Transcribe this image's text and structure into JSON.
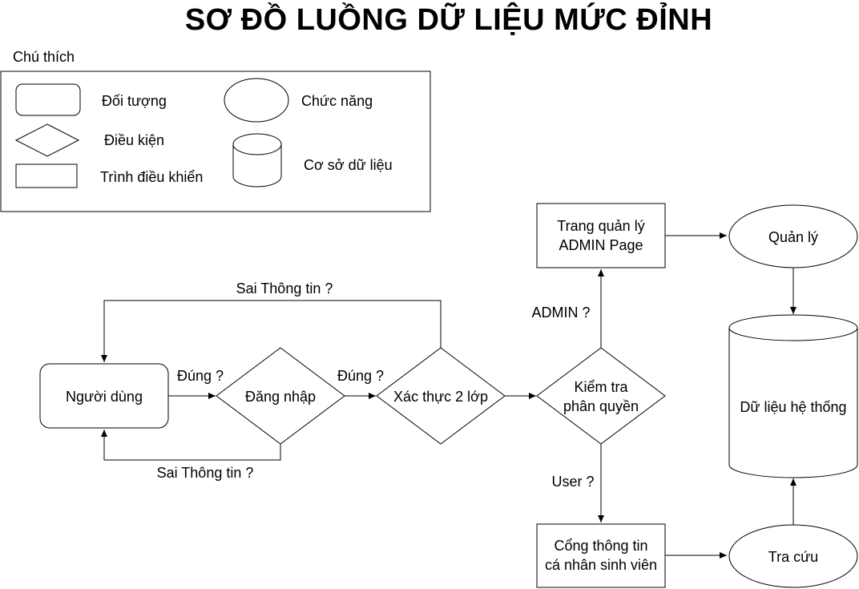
{
  "title": "SƠ ĐỒ LUỒNG DỮ LIỆU MỨC ĐỈNH",
  "legend": {
    "heading": "Chú thích",
    "object": "Đối tượng",
    "function": "Chức năng",
    "condition": "Điều kiện",
    "database": "Cơ sở dữ liệu",
    "controller": "Trình điều khiển"
  },
  "nodes": {
    "user": "Người dùng",
    "login": "Đăng nhập",
    "twofa": "Xác thực 2 lớp",
    "perm_line1": "Kiểm tra",
    "perm_line2": "phân quyền",
    "admin_line1": "Trang quản lý",
    "admin_line2": "ADMIN Page",
    "portal_line1": "Cổng thông tin",
    "portal_line2": "cá nhân sinh viên",
    "manage": "Quản lý",
    "lookup": "Tra cứu",
    "db": "Dữ liệu hệ thống"
  },
  "edges": {
    "wrong_top": "Sai Thông tin ?",
    "wrong_bottom": "Sai Thông tin ?",
    "correct1": "Đúng ?",
    "correct2": "Đúng ?",
    "admin": "ADMIN ?",
    "user": "User ?"
  }
}
